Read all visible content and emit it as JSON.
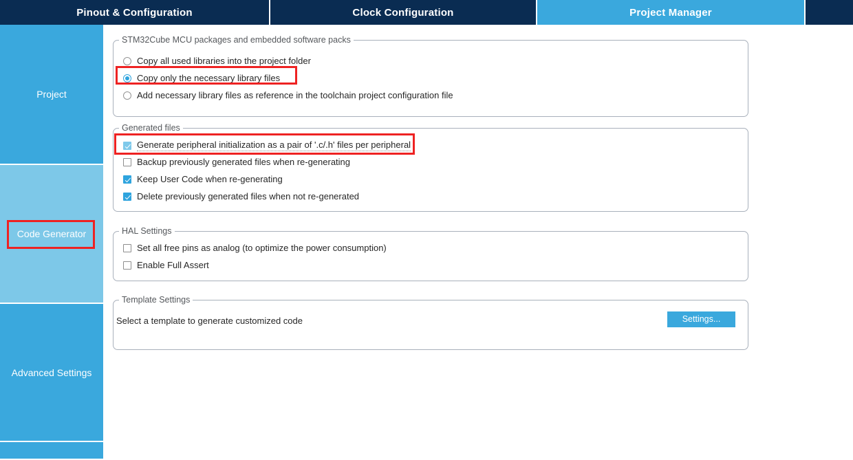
{
  "tabs": [
    {
      "label": "Pinout & Configuration",
      "active": false
    },
    {
      "label": "Clock Configuration",
      "active": false
    },
    {
      "label": "Project Manager",
      "active": true
    }
  ],
  "sidebar": {
    "items": [
      {
        "label": "Project"
      },
      {
        "label": "Code Generator"
      },
      {
        "label": "Advanced Settings"
      }
    ]
  },
  "colors": {
    "tabbar_background": "#0a2c52",
    "accent": "#3aa8dd",
    "sidebar_selected": "#7dc8e8",
    "highlight": "#ee2222",
    "checkbox_checked": "#2fa4de",
    "groupbox_border": "#a8b0bb"
  },
  "groups": {
    "packages": {
      "legend": "STM32Cube MCU packages and embedded software packs",
      "options": [
        {
          "label": "Copy all used libraries into the project folder",
          "checked": false
        },
        {
          "label": "Copy only the necessary library files",
          "checked": true
        },
        {
          "label": "Add necessary library files as reference in the toolchain project configuration file",
          "checked": false
        }
      ]
    },
    "generated_files": {
      "legend": "Generated files",
      "options": [
        {
          "label": "Generate peripheral initialization as a pair of '.c/.h' files per peripheral",
          "checked": true,
          "focused": true
        },
        {
          "label": "Backup previously generated files when re-generating",
          "checked": false,
          "focused": false
        },
        {
          "label": "Keep User Code when re-generating",
          "checked": true,
          "focused": false
        },
        {
          "label": "Delete previously generated files when not re-generated",
          "checked": true,
          "focused": false
        }
      ]
    },
    "hal_settings": {
      "legend": "HAL Settings",
      "options": [
        {
          "label": "Set all free pins as analog (to optimize the power consumption)",
          "checked": false
        },
        {
          "label": "Enable Full Assert",
          "checked": false
        }
      ]
    },
    "template_settings": {
      "legend": "Template Settings",
      "description": "Select a template to generate customized code",
      "settings_button": "Settings..."
    }
  }
}
